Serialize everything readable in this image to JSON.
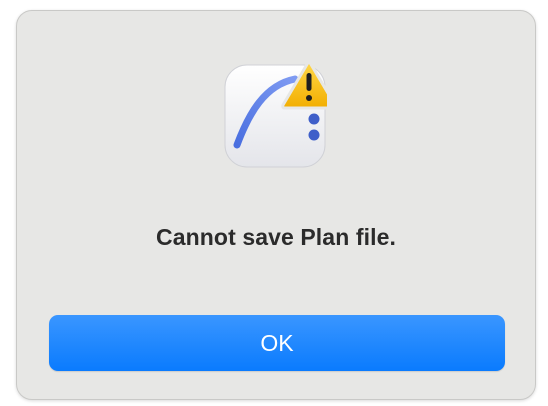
{
  "dialog": {
    "message": "Cannot save Plan file.",
    "ok_label": "OK",
    "icons": {
      "app": "plan-app-icon",
      "warning": "warning-triangle-icon"
    },
    "colors": {
      "button": "#0a7bfe",
      "button_text": "#ffffff",
      "background": "#e7e7e5",
      "text": "#2b2b2b",
      "warning": "#f6b800"
    }
  }
}
